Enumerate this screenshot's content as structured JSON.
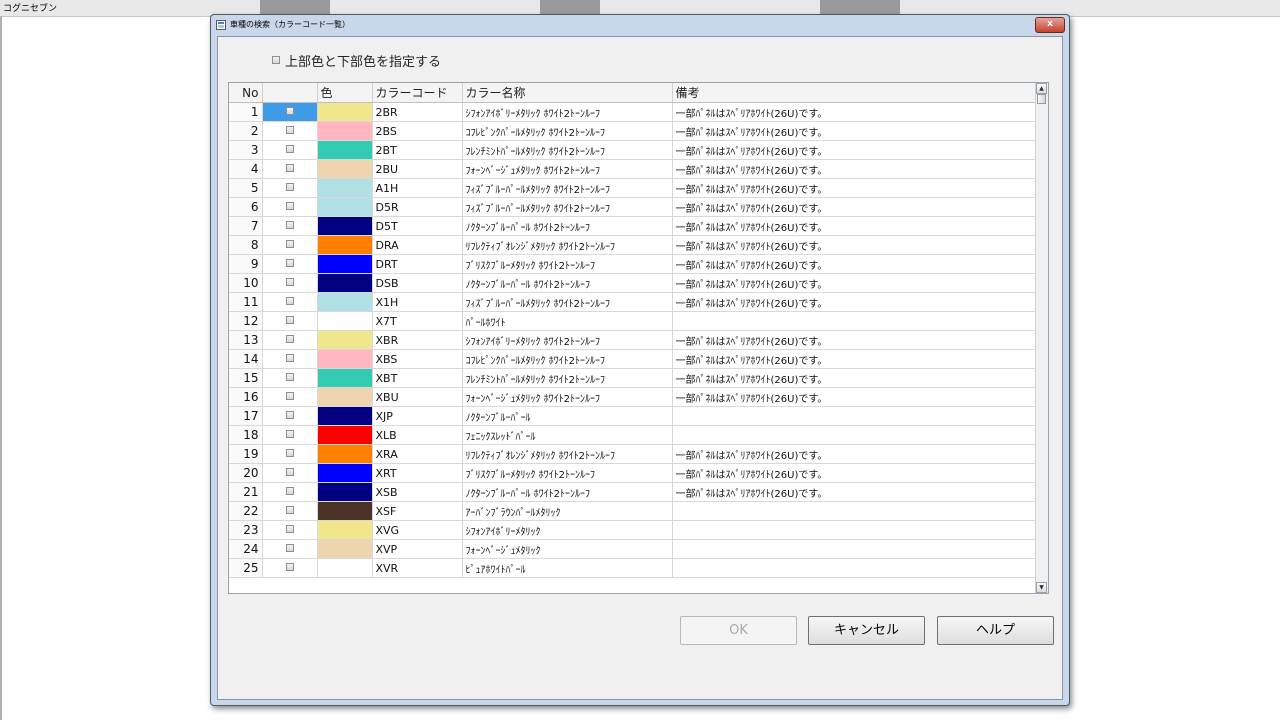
{
  "app": {
    "title": "コグニセブン"
  },
  "dialog": {
    "title": "車種の検索（カラーコード一覧）",
    "close_label": "x",
    "checkbox_label": "上部色と下部色を指定する"
  },
  "grid": {
    "headers": {
      "no": "No",
      "check": "",
      "color": "色",
      "code": "カラーコード",
      "name": "カラー名称",
      "note": "備考"
    },
    "rows": [
      {
        "no": "1",
        "color": "#f0e68c",
        "code": "2BR",
        "name": "ｼﾌｫﾝｱｲﾎﾞﾘｰﾒﾀﾘｯｸ ﾎﾜｲﾄ2ﾄｰﾝﾙｰﾌ",
        "note": "一部ﾊﾟﾈﾙはｽﾍﾟﾘｱﾎﾜｲﾄ(26U)です。",
        "selected": true
      },
      {
        "no": "2",
        "color": "#ffb6c1",
        "code": "2BS",
        "name": "ｺﾌﾚﾋﾟﾝｸﾊﾟｰﾙﾒﾀﾘｯｸ ﾎﾜｲﾄ2ﾄｰﾝﾙｰﾌ",
        "note": "一部ﾊﾟﾈﾙはｽﾍﾟﾘｱﾎﾜｲﾄ(26U)です。"
      },
      {
        "no": "3",
        "color": "#33ccb3",
        "code": "2BT",
        "name": "ﾌﾚﾝﾁﾐﾝﾄﾊﾟｰﾙﾒﾀﾘｯｸ ﾎﾜｲﾄ2ﾄｰﾝﾙｰﾌ",
        "note": "一部ﾊﾟﾈﾙはｽﾍﾟﾘｱﾎﾜｲﾄ(26U)です。"
      },
      {
        "no": "4",
        "color": "#eed5b0",
        "code": "2BU",
        "name": "ﾌｫｰﾝﾍﾞｰｼﾞｭﾒﾀﾘｯｸ ﾎﾜｲﾄ2ﾄｰﾝﾙｰﾌ",
        "note": "一部ﾊﾟﾈﾙはｽﾍﾟﾘｱﾎﾜｲﾄ(26U)です。"
      },
      {
        "no": "5",
        "color": "#b0dfe6",
        "code": "A1H",
        "name": "ﾌｨｽﾞﾌﾞﾙｰﾊﾟｰﾙﾒﾀﾘｯｸ ﾎﾜｲﾄ2ﾄｰﾝﾙｰﾌ",
        "note": "一部ﾊﾟﾈﾙはｽﾍﾟﾘｱﾎﾜｲﾄ(26U)です。"
      },
      {
        "no": "6",
        "color": "#b0dfe6",
        "code": "D5R",
        "name": "ﾌｨｽﾞﾌﾞﾙｰﾊﾟｰﾙﾒﾀﾘｯｸ ﾎﾜｲﾄ2ﾄｰﾝﾙｰﾌ",
        "note": "一部ﾊﾟﾈﾙはｽﾍﾟﾘｱﾎﾜｲﾄ(26U)です。"
      },
      {
        "no": "7",
        "color": "#000080",
        "code": "D5T",
        "name": "ﾉｸﾀｰﾝﾌﾞﾙｰﾊﾟｰﾙ ﾎﾜｲﾄ2ﾄｰﾝﾙｰﾌ",
        "note": "一部ﾊﾟﾈﾙはｽﾍﾟﾘｱﾎﾜｲﾄ(26U)です。"
      },
      {
        "no": "8",
        "color": "#ff8000",
        "code": "DRA",
        "name": "ﾘﾌﾚｸﾃｨﾌﾞｵﾚﾝｼﾞﾒﾀﾘｯｸ ﾎﾜｲﾄ2ﾄｰﾝﾙｰﾌ",
        "note": "一部ﾊﾟﾈﾙはｽﾍﾟﾘｱﾎﾜｲﾄ(26U)です。"
      },
      {
        "no": "9",
        "color": "#0000ff",
        "code": "DRT",
        "name": "ﾌﾞﾘｽｸﾌﾞﾙｰﾒﾀﾘｯｸ ﾎﾜｲﾄ2ﾄｰﾝﾙｰﾌ",
        "note": "一部ﾊﾟﾈﾙはｽﾍﾟﾘｱﾎﾜｲﾄ(26U)です。"
      },
      {
        "no": "10",
        "color": "#000080",
        "code": "DSB",
        "name": "ﾉｸﾀｰﾝﾌﾞﾙｰﾊﾟｰﾙ ﾎﾜｲﾄ2ﾄｰﾝﾙｰﾌ",
        "note": "一部ﾊﾟﾈﾙはｽﾍﾟﾘｱﾎﾜｲﾄ(26U)です。"
      },
      {
        "no": "11",
        "color": "#b0dfe6",
        "code": "X1H",
        "name": "ﾌｨｽﾞﾌﾞﾙｰﾊﾟｰﾙﾒﾀﾘｯｸ ﾎﾜｲﾄ2ﾄｰﾝﾙｰﾌ",
        "note": "一部ﾊﾟﾈﾙはｽﾍﾟﾘｱﾎﾜｲﾄ(26U)です。"
      },
      {
        "no": "12",
        "color": "#ffffff",
        "code": "X7T",
        "name": "ﾊﾟｰﾙﾎﾜｲﾄ",
        "note": ""
      },
      {
        "no": "13",
        "color": "#f0e68c",
        "code": "XBR",
        "name": "ｼﾌｫﾝｱｲﾎﾞﾘｰﾒﾀﾘｯｸ ﾎﾜｲﾄ2ﾄｰﾝﾙｰﾌ",
        "note": "一部ﾊﾟﾈﾙはｽﾍﾟﾘｱﾎﾜｲﾄ(26U)です。"
      },
      {
        "no": "14",
        "color": "#ffb6c1",
        "code": "XBS",
        "name": "ｺﾌﾚﾋﾟﾝｸﾊﾟｰﾙﾒﾀﾘｯｸ ﾎﾜｲﾄ2ﾄｰﾝﾙｰﾌ",
        "note": "一部ﾊﾟﾈﾙはｽﾍﾟﾘｱﾎﾜｲﾄ(26U)です。"
      },
      {
        "no": "15",
        "color": "#33ccb3",
        "code": "XBT",
        "name": "ﾌﾚﾝﾁﾐﾝﾄﾊﾟｰﾙﾒﾀﾘｯｸ ﾎﾜｲﾄ2ﾄｰﾝﾙｰﾌ",
        "note": "一部ﾊﾟﾈﾙはｽﾍﾟﾘｱﾎﾜｲﾄ(26U)です。"
      },
      {
        "no": "16",
        "color": "#eed5b0",
        "code": "XBU",
        "name": "ﾌｫｰﾝﾍﾞｰｼﾞｭﾒﾀﾘｯｸ ﾎﾜｲﾄ2ﾄｰﾝﾙｰﾌ",
        "note": "一部ﾊﾟﾈﾙはｽﾍﾟﾘｱﾎﾜｲﾄ(26U)です。"
      },
      {
        "no": "17",
        "color": "#000080",
        "code": "XJP",
        "name": "ﾉｸﾀｰﾝﾌﾞﾙｰﾊﾟｰﾙ",
        "note": ""
      },
      {
        "no": "18",
        "color": "#ff0000",
        "code": "XLB",
        "name": "ﾌｪﾆｯｸｽﾚｯﾄﾞﾊﾟｰﾙ",
        "note": ""
      },
      {
        "no": "19",
        "color": "#ff8000",
        "code": "XRA",
        "name": "ﾘﾌﾚｸﾃｨﾌﾞｵﾚﾝｼﾞﾒﾀﾘｯｸ ﾎﾜｲﾄ2ﾄｰﾝﾙｰﾌ",
        "note": "一部ﾊﾟﾈﾙはｽﾍﾟﾘｱﾎﾜｲﾄ(26U)です。"
      },
      {
        "no": "20",
        "color": "#0000ff",
        "code": "XRT",
        "name": "ﾌﾞﾘｽｸﾌﾞﾙｰﾒﾀﾘｯｸ ﾎﾜｲﾄ2ﾄｰﾝﾙｰﾌ",
        "note": "一部ﾊﾟﾈﾙはｽﾍﾟﾘｱﾎﾜｲﾄ(26U)です。"
      },
      {
        "no": "21",
        "color": "#000080",
        "code": "XSB",
        "name": "ﾉｸﾀｰﾝﾌﾞﾙｰﾊﾟｰﾙ ﾎﾜｲﾄ2ﾄｰﾝﾙｰﾌ",
        "note": "一部ﾊﾟﾈﾙはｽﾍﾟﾘｱﾎﾜｲﾄ(26U)です。"
      },
      {
        "no": "22",
        "color": "#4a3326",
        "code": "XSF",
        "name": "ｱｰﾊﾞﾝﾌﾞﾗｳﾝﾊﾟｰﾙﾒﾀﾘｯｸ",
        "note": ""
      },
      {
        "no": "23",
        "color": "#f0e68c",
        "code": "XVG",
        "name": "ｼﾌｫﾝｱｲﾎﾞﾘｰﾒﾀﾘｯｸ",
        "note": ""
      },
      {
        "no": "24",
        "color": "#eed5b0",
        "code": "XVP",
        "name": "ﾌｫｰﾝﾍﾞｰｼﾞｭﾒﾀﾘｯｸ",
        "note": ""
      },
      {
        "no": "25",
        "color": "#ffffff",
        "code": "XVR",
        "name": "ﾋﾟｭｱﾎﾜｲﾄﾊﾟｰﾙ",
        "note": ""
      }
    ]
  },
  "buttons": {
    "ok": "OK",
    "cancel": "キャンセル",
    "help": "ヘルプ"
  }
}
